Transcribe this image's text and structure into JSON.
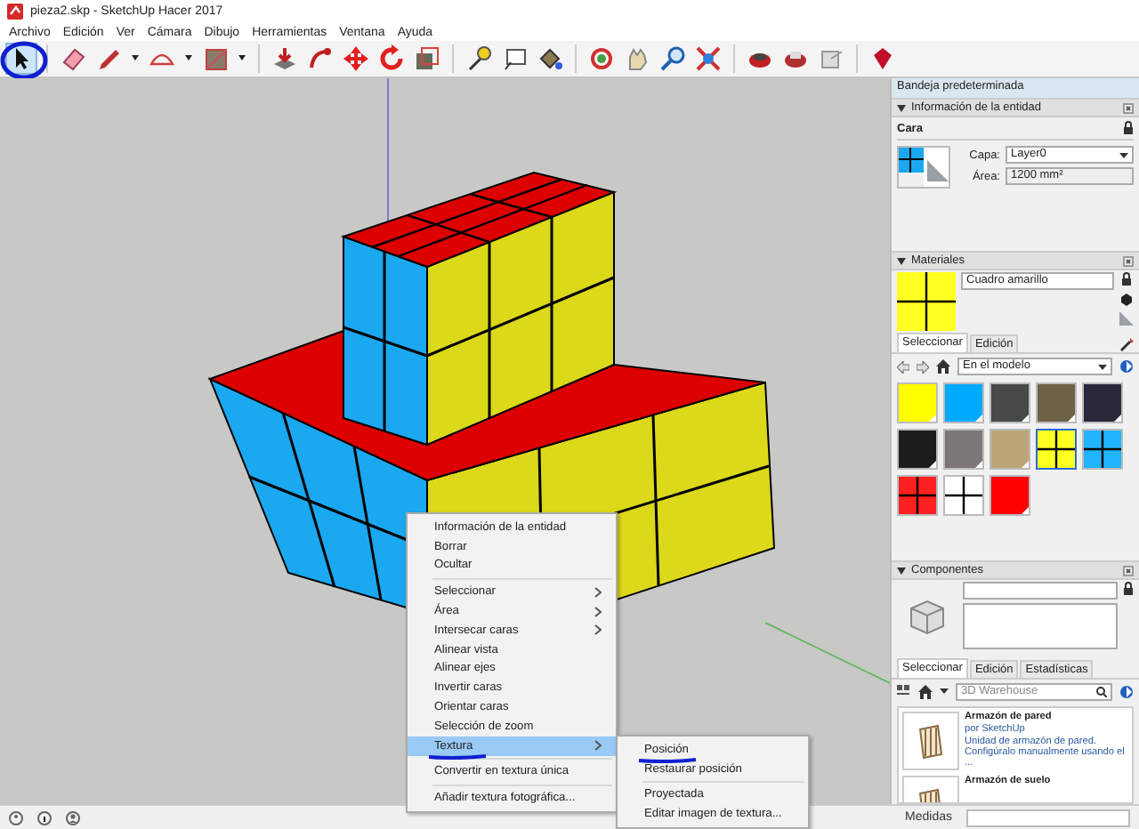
{
  "window": {
    "title": "pieza2.skp - SketchUp Hacer 2017"
  },
  "menu": [
    "Archivo",
    "Edición",
    "Ver",
    "Cámara",
    "Dibujo",
    "Herramientas",
    "Ventana",
    "Ayuda"
  ],
  "toolbar": [
    {
      "selected": true,
      "marked": true
    },
    {
      "selected": false
    },
    {
      "selected": false
    },
    {
      "selected": false
    },
    {
      "selected": false
    },
    {
      "selected": false
    },
    {
      "selected": false
    },
    {
      "selected": false
    },
    {
      "selected": false
    },
    {
      "selected": false
    },
    {
      "selected": false
    },
    {
      "selected": false
    },
    {
      "selected": false
    },
    {
      "selected": false
    },
    {
      "selected": false
    },
    {
      "selected": false
    },
    {
      "selected": false
    },
    {
      "selected": false
    },
    {
      "selected": false
    },
    {
      "selected": false
    },
    {
      "selected": false
    }
  ],
  "context_menu": {
    "groups": [
      [
        {
          "label": "Información de la entidad",
          "submenu": false,
          "selected": false,
          "marked": false
        },
        {
          "label": "Borrar",
          "submenu": false,
          "selected": false,
          "marked": false
        },
        {
          "label": "Ocultar",
          "submenu": false,
          "selected": false,
          "marked": false
        }
      ],
      [
        {
          "label": "Seleccionar",
          "submenu": true,
          "selected": false,
          "marked": false
        },
        {
          "label": "Área",
          "submenu": true,
          "selected": false,
          "marked": false
        },
        {
          "label": "Intersecar caras",
          "submenu": true,
          "selected": false,
          "marked": false
        },
        {
          "label": "Alinear vista",
          "submenu": false,
          "selected": false,
          "marked": false
        },
        {
          "label": "Alinear ejes",
          "submenu": false,
          "selected": false,
          "marked": false
        },
        {
          "label": "Invertir caras",
          "submenu": false,
          "selected": false,
          "marked": false
        },
        {
          "label": "Orientar caras",
          "submenu": false,
          "selected": false,
          "marked": false
        },
        {
          "label": "Selección de zoom",
          "submenu": false,
          "selected": false,
          "marked": false
        },
        {
          "label": "Textura",
          "submenu": true,
          "selected": true,
          "marked": true
        }
      ],
      [
        {
          "label": "Convertir en textura única",
          "submenu": false,
          "selected": false,
          "marked": false
        }
      ],
      [
        {
          "label": "Añadir textura fotográfica...",
          "submenu": false,
          "selected": false,
          "marked": false
        }
      ]
    ]
  },
  "submenu": {
    "groups": [
      [
        {
          "label": "Posición",
          "selected": false,
          "marked": true
        },
        {
          "label": "Restaurar posición",
          "selected": false,
          "marked": false
        }
      ],
      [
        {
          "label": "Proyectada",
          "selected": false,
          "marked": false
        },
        {
          "label": "Editar imagen de textura...",
          "selected": false,
          "marked": false
        }
      ]
    ]
  },
  "tray": {
    "title": "Bandeja predeterminada",
    "entity_info": {
      "title": "Información de la entidad",
      "type": "Cara",
      "layer_label": "Capa:",
      "layer": "Layer0",
      "area_label": "Área:",
      "area": "1200 mm²"
    },
    "materials": {
      "title": "Materiales",
      "name": "Cuadro amarillo",
      "tabs": [
        {
          "label": "Seleccionar",
          "selected": true
        },
        {
          "label": "Edición",
          "selected": false
        }
      ],
      "collection": "En el modelo",
      "swatches": [
        {
          "kind": "solid",
          "color": "#ffff00",
          "selected": false
        },
        {
          "kind": "solid",
          "color": "#00aaff",
          "selected": false
        },
        {
          "kind": "solid",
          "color": "#464a48",
          "selected": false
        },
        {
          "kind": "solid",
          "color": "#6e6148",
          "selected": false
        },
        {
          "kind": "solid",
          "color": "#28283a",
          "selected": false
        },
        {
          "kind": "solid",
          "color": "#1c1c1c",
          "selected": false
        },
        {
          "kind": "solid",
          "color": "#7a7776",
          "selected": false
        },
        {
          "kind": "solid",
          "color": "#bca678",
          "selected": false
        },
        {
          "kind": "grid",
          "color": "#ffff22",
          "selected": true
        },
        {
          "kind": "grid",
          "color": "#22b4ff",
          "selected": false
        },
        {
          "kind": "grid",
          "color": "#ff2020",
          "selected": false
        },
        {
          "kind": "grid",
          "color": "#ffffff",
          "selected": false
        },
        {
          "kind": "solid",
          "color": "#ff0000",
          "selected": false
        }
      ]
    },
    "components": {
      "title": "Componentes",
      "tabs": [
        {
          "label": "Seleccionar",
          "selected": true
        },
        {
          "label": "Edición",
          "selected": false
        },
        {
          "label": "Estadísticas",
          "selected": false
        }
      ],
      "search": "3D Warehouse",
      "items": [
        {
          "title": "Armazón de pared",
          "author": "por SketchUp",
          "description": "Unidad de armazón de pared. Configúralo manualmente usando el ..."
        },
        {
          "title": "Armazón de suelo"
        }
      ]
    }
  },
  "status_bar": {
    "measurements_label": "Medidas"
  }
}
